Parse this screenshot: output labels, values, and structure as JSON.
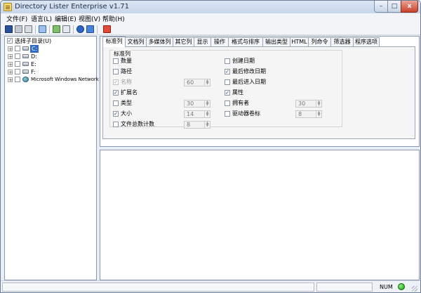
{
  "window": {
    "title": "Directory Lister Enterprise v1.71",
    "controls": {
      "minimize": "–",
      "maximize": "□",
      "close": "x"
    }
  },
  "menu": [
    {
      "label": "文件(F)"
    },
    {
      "label": "语言(L)"
    },
    {
      "label": "编辑(E)"
    },
    {
      "label": "视图(V)"
    },
    {
      "label": "帮助(H)"
    }
  ],
  "toolbar": {
    "icons": [
      "save-icon",
      "print-icon",
      "print-preview-icon",
      "copy-icon",
      "export-icon",
      "export-html-icon",
      "help-icon",
      "about-icon",
      "exit-icon"
    ]
  },
  "tree": {
    "root_label": "选择子目录(U)",
    "items": [
      {
        "label": "C:",
        "selected": true
      },
      {
        "label": "D:",
        "selected": false
      },
      {
        "label": "E:",
        "selected": false
      },
      {
        "label": "F:",
        "selected": false
      },
      {
        "label": "Microsoft Windows Network",
        "selected": false
      }
    ]
  },
  "tabs": [
    {
      "label": "标准列",
      "active": true
    },
    {
      "label": "文档列"
    },
    {
      "label": "多媒体列"
    },
    {
      "label": "其它列"
    },
    {
      "label": "显示"
    },
    {
      "label": "操作"
    },
    {
      "label": "格式与排序"
    },
    {
      "label": "输出类型"
    },
    {
      "label": "HTML"
    },
    {
      "label": "列命令"
    },
    {
      "label": "筛选器"
    },
    {
      "label": "程序选项"
    }
  ],
  "standard_columns": {
    "group_title": "标准列",
    "left": [
      {
        "label": "数量",
        "checked": false
      },
      {
        "label": "路径",
        "checked": false
      },
      {
        "label": "名称",
        "checked": true,
        "disabled": true,
        "width": "60"
      },
      {
        "label": "扩展名",
        "checked": true
      },
      {
        "label": "类型",
        "checked": false,
        "width": "30"
      },
      {
        "label": "大小",
        "checked": true,
        "width": "14"
      },
      {
        "label": "文件总数计数",
        "checked": false,
        "width": "8"
      }
    ],
    "right": [
      {
        "label": "创建日期",
        "checked": false
      },
      {
        "label": "最后修改日期",
        "checked": true
      },
      {
        "label": "最后进入日期",
        "checked": false
      },
      {
        "label": "属性",
        "checked": true
      },
      {
        "label": "拥有者",
        "checked": false,
        "width": "30"
      },
      {
        "label": "驱动器卷标",
        "checked": false,
        "width": "8"
      }
    ]
  },
  "status": {
    "num": "NUM",
    "indicator_color": "#1aa51a"
  },
  "colors": {
    "title_bar": "#c7d6ea",
    "selection": "#316ac5",
    "close_button": "#c8422c"
  }
}
